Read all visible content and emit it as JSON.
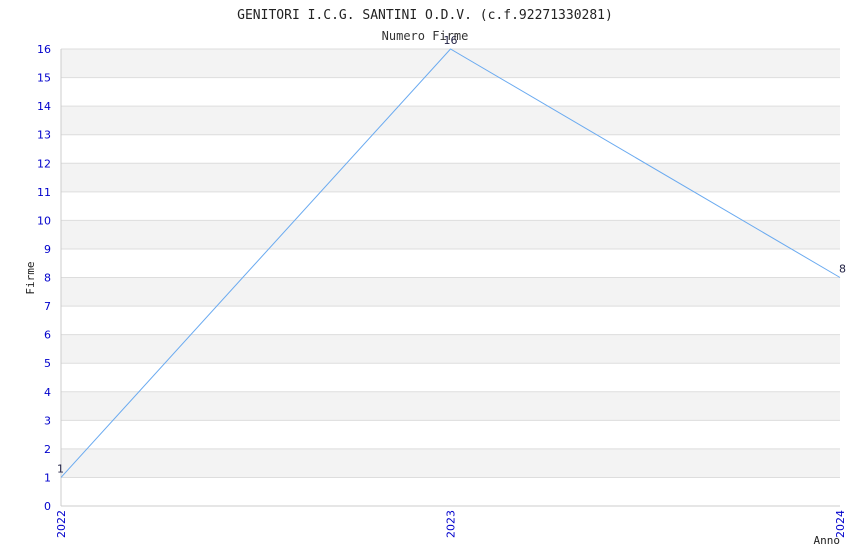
{
  "chart_data": {
    "type": "line",
    "title": "GENITORI I.C.G. SANTINI O.D.V. (c.f.92271330281)",
    "subtitle": "Numero Firme",
    "xlabel": "Anno",
    "ylabel": "Firme",
    "x": [
      "2022",
      "2023",
      "2024"
    ],
    "series": [
      {
        "values": [
          1,
          16,
          8
        ],
        "labels": [
          "1",
          "16",
          "8"
        ]
      }
    ],
    "ylim": [
      0,
      16
    ],
    "yticks": [
      "0",
      "1",
      "2",
      "3",
      "4",
      "5",
      "6",
      "7",
      "8",
      "9",
      "10",
      "11",
      "12",
      "13",
      "14",
      "15",
      "16"
    ],
    "grid": true,
    "colors": {
      "line": "#6aaaf0",
      "band": "#f3f3f3",
      "gridline": "#dddddd",
      "tick": "#0000cc"
    }
  }
}
